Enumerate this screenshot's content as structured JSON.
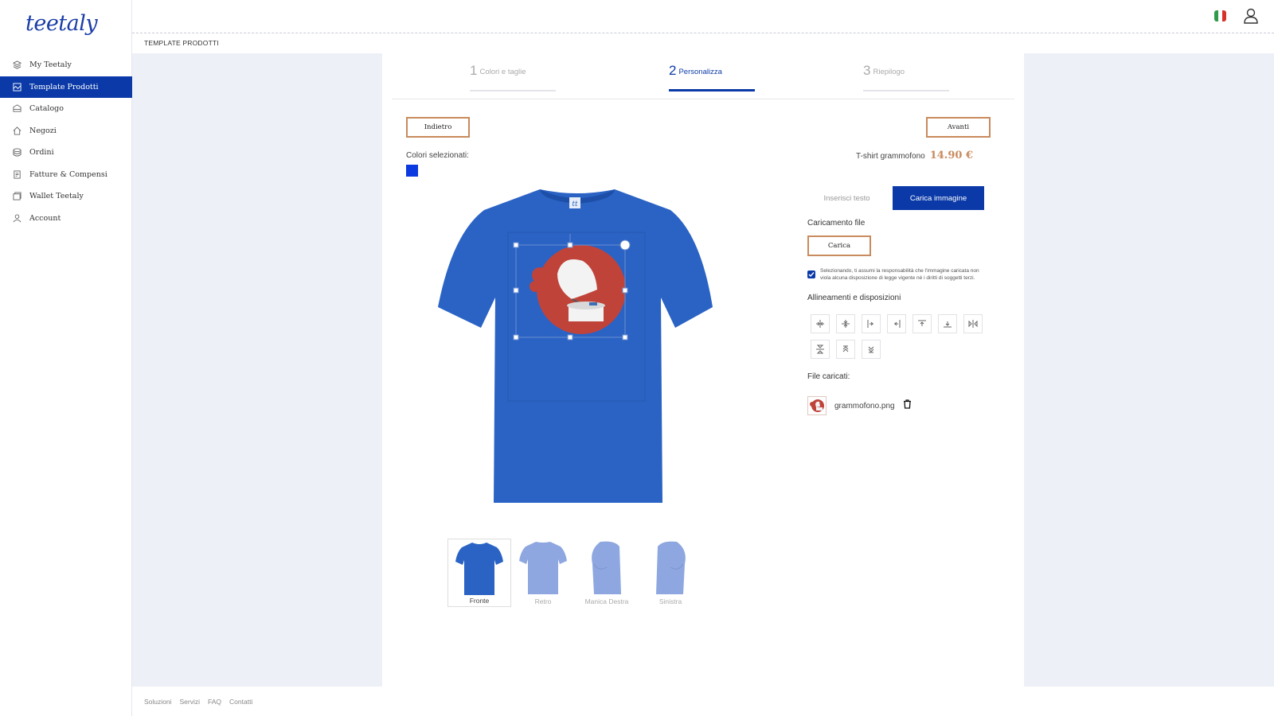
{
  "brand": {
    "logo": "teetaly"
  },
  "sidebar": {
    "items": [
      {
        "label": "My Teetaly",
        "icon": "layers-icon",
        "active": false
      },
      {
        "label": "Template Prodotti",
        "icon": "template-icon",
        "active": true
      },
      {
        "label": "Catalogo",
        "icon": "catalog-icon",
        "active": false
      },
      {
        "label": "Negozi",
        "icon": "store-icon",
        "active": false
      },
      {
        "label": "Ordini",
        "icon": "orders-icon",
        "active": false
      },
      {
        "label": "Fatture & Compensi",
        "icon": "invoice-icon",
        "active": false
      },
      {
        "label": "Wallet Teetaly",
        "icon": "wallet-icon",
        "active": false
      },
      {
        "label": "Account",
        "icon": "user-icon",
        "active": false
      }
    ]
  },
  "topbar": {
    "language_flag": "italian-flag-icon",
    "account_icon": "user-icon"
  },
  "breadcrumb": "TEMPLATE PRODOTTI",
  "stepper": {
    "steps": [
      {
        "num": "1",
        "label": "Colori e taglie",
        "active": false
      },
      {
        "num": "2",
        "label": "Personalizza",
        "active": true
      },
      {
        "num": "3",
        "label": "Riepilogo",
        "active": false
      }
    ]
  },
  "nav_buttons": {
    "back": "Indietro",
    "next": "Avanti"
  },
  "colors": {
    "label": "Colori selezionati:",
    "selected": [
      "#0b3ae0"
    ]
  },
  "product": {
    "name": "T-shirt grammofono",
    "price": "14.90 €",
    "shirt_color": "#2a63c4",
    "accent": "#c98a5d",
    "primary": "#0b3aa8"
  },
  "views": [
    {
      "label": "Fronte",
      "selected": true
    },
    {
      "label": "Retro",
      "selected": false
    },
    {
      "label": "Manica Destra",
      "selected": false
    },
    {
      "label": "Sinistra",
      "selected": false
    }
  ],
  "editor": {
    "tabs": [
      {
        "label": "Inserisci testo",
        "active": false
      },
      {
        "label": "Carica immagine",
        "active": true
      }
    ],
    "upload_section": "Caricamento file",
    "upload_button": "Carica",
    "consent_checked": true,
    "consent_text": "Selezionando, ti assumi la responsabilità che l'immagine caricata non viola alcuna disposizione di legge vigente né i diritti di soggetti terzi.",
    "align_section": "Allineamenti e disposizioni",
    "align_tools": [
      "align-center-horizontal-icon",
      "align-center-vertical-icon",
      "align-left-icon",
      "align-right-icon",
      "align-top-icon",
      "align-bottom-icon",
      "flip-horizontal-icon",
      "flip-vertical-icon",
      "bring-forward-icon",
      "send-backward-icon"
    ],
    "files_section": "File caricati:",
    "files": [
      {
        "name": "grammofono.png"
      }
    ]
  },
  "footer": {
    "links": [
      "Soluzioni",
      "Servizi",
      "FAQ",
      "Contatti"
    ]
  }
}
